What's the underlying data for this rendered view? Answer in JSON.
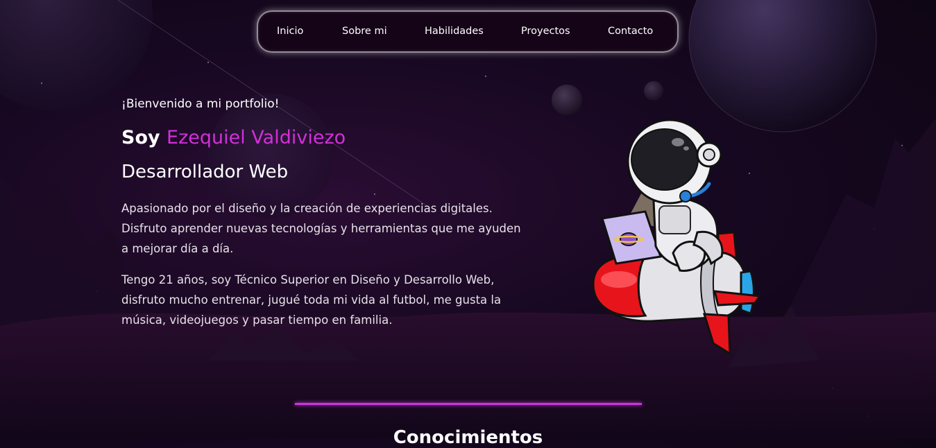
{
  "nav": {
    "items": [
      "Inicio",
      "Sobre mi",
      "Habilidades",
      "Proyectos",
      "Contacto"
    ]
  },
  "hero": {
    "welcome": "¡Bienvenido a mi portfolio!",
    "name_prefix": "Soy",
    "name": "Ezequiel Valdiviezo",
    "role": "Desarrollador Web",
    "paragraphs": [
      "Apasionado por el diseño y la creación de experiencias digitales. Disfruto aprender nuevas tecnologías y herramientas que me ayuden a mejorar día a día.",
      "Tengo 21 años, soy Técnico Superior en Diseño y Desarrollo Web, disfruto mucho entrenar, jugué toda mi vida al futbol, me gusta la música, videojuegos y pasar tiempo en familia."
    ],
    "illustration": "astronaut-on-rocket-with-laptop"
  },
  "sections": {
    "next_title": "Conocimientos"
  },
  "colors": {
    "accent": "#d230d8",
    "background": "#170821",
    "nav_background": "#16041a"
  }
}
